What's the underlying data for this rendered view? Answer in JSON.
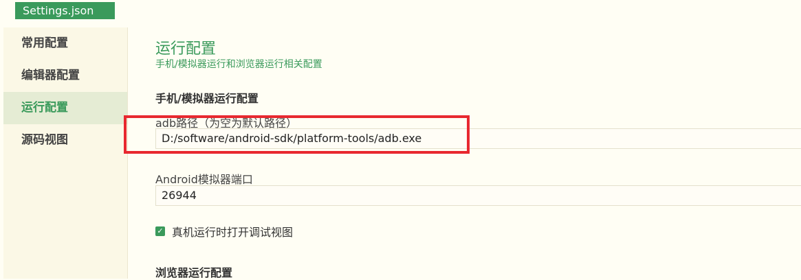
{
  "tab": {
    "label": "Settings.json"
  },
  "sidebar": {
    "items": [
      {
        "label": "常用配置"
      },
      {
        "label": "编辑器配置"
      },
      {
        "label": "运行配置"
      },
      {
        "label": "源码视图"
      }
    ],
    "active_index": 2
  },
  "main": {
    "title": "运行配置",
    "subtitle": "手机/模拟器运行和浏览器运行相关配置",
    "section_mobile": "手机/模拟器运行配置",
    "adb_label": "adb路径（为空为默认路径）",
    "adb_value": "D:/software/android-sdk/platform-tools/adb.exe",
    "emulator_port_label": "Android模拟器端口",
    "emulator_port_value": "26944",
    "debug_checkbox_label": "真机运行时打开调试视图",
    "debug_checkbox_checked": true,
    "section_browser": "浏览器运行配置"
  },
  "colors": {
    "accent": "#3a9a5b",
    "highlight_box": "#e8282f",
    "background": "#fffef4"
  }
}
